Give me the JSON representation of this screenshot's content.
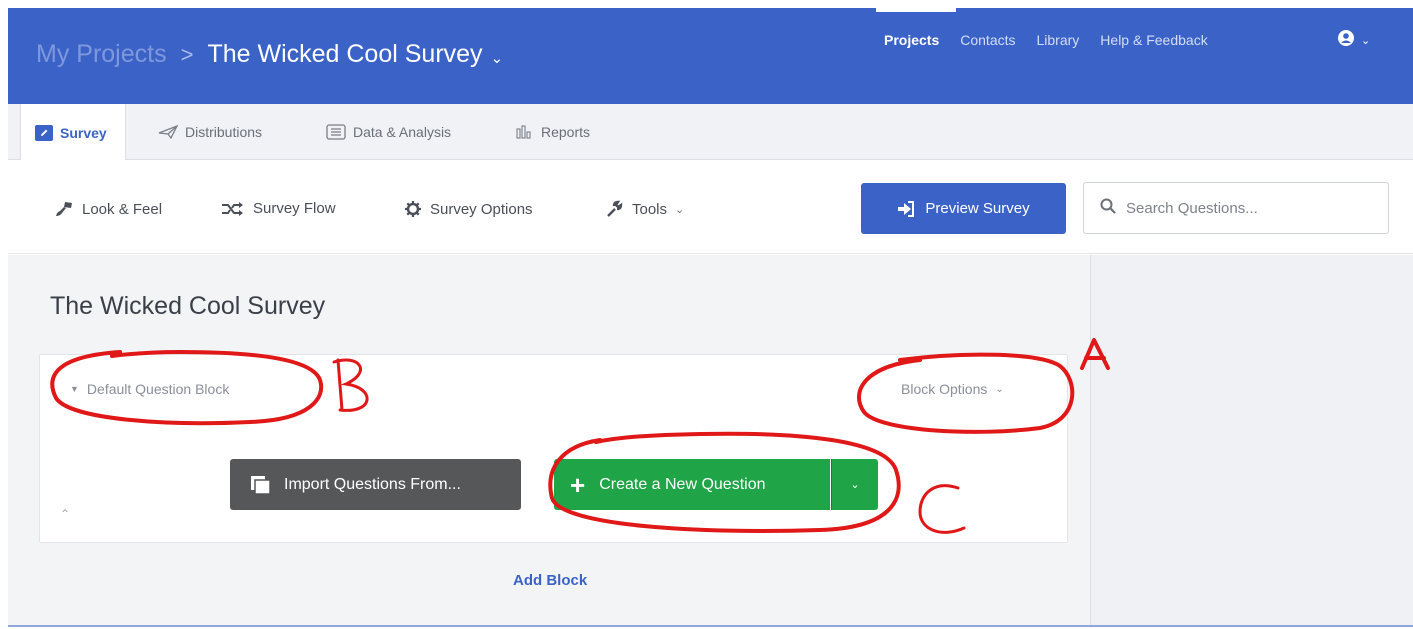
{
  "header": {
    "breadcrumb_parent": "My Projects",
    "breadcrumb_separator": ">",
    "project_title": "The Wicked Cool Survey",
    "nav": [
      "Projects",
      "Contacts",
      "Library",
      "Help & Feedback"
    ],
    "user_icon": "user-circle-icon"
  },
  "tabs": [
    {
      "label": "Survey",
      "icon": "pencil-icon"
    },
    {
      "label": "Distributions",
      "icon": "paper-plane-icon"
    },
    {
      "label": "Data & Analysis",
      "icon": "list-icon"
    },
    {
      "label": "Reports",
      "icon": "bar-chart-icon"
    }
  ],
  "toolbar": {
    "look_feel": "Look & Feel",
    "survey_flow": "Survey Flow",
    "survey_options": "Survey Options",
    "tools": "Tools",
    "preview": "Preview Survey",
    "search_placeholder": "Search Questions..."
  },
  "main": {
    "survey_title": "The Wicked Cool Survey",
    "block": {
      "name": "Default Question Block",
      "options_label": "Block Options",
      "import_label": "Import Questions From...",
      "create_label": "Create a New Question"
    },
    "add_block": "Add Block"
  },
  "annotations": {
    "a": "A",
    "b": "B",
    "c": "C"
  },
  "colors": {
    "brand_blue": "#3b63c7",
    "create_green": "#1fa447",
    "import_gray": "#555759",
    "annotation_red": "#e01818"
  }
}
